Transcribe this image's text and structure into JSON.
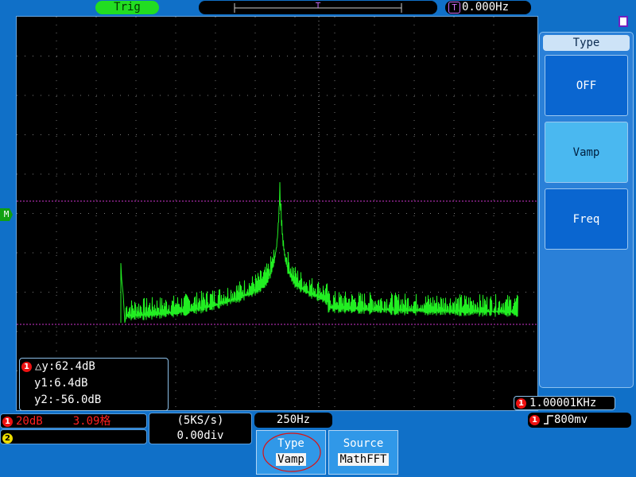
{
  "header": {
    "trigger_label": "Trig",
    "trig_freq_badge": "T",
    "trig_freq_value": "0.000Hz",
    "time_position_badge": "T"
  },
  "menu": {
    "title": "Type",
    "items": [
      {
        "label": "OFF",
        "selected": false
      },
      {
        "label": "Vamp",
        "selected": true
      },
      {
        "label": "Freq",
        "selected": false
      }
    ]
  },
  "measurement": {
    "channel_badge": "1",
    "delta": "△y:62.4dB",
    "y1": "y1:6.4dB",
    "y2": "y2:-56.0dB"
  },
  "channel1": {
    "badge": "1",
    "scale": "20dB",
    "offset": "3.09格"
  },
  "channel2": {
    "badge": "2"
  },
  "acquisition": {
    "sample_rate": "(5KS/s)",
    "position": "0.00div",
    "fft_span": "250Hz"
  },
  "readout": {
    "badge": "1",
    "frequency": "1.00001KHz"
  },
  "trigger": {
    "badge": "1",
    "level": "800mv",
    "slope_icon": "rising-edge-icon"
  },
  "softkeys": [
    {
      "label": "Type",
      "value": "Vamp",
      "highlighted": true
    },
    {
      "label": "Source",
      "value": "MathFFT",
      "highlighted": false
    }
  ],
  "math_marker": "M",
  "colors": {
    "trace": "#22ee22",
    "cursor": "#cc33cc",
    "background": "#1070c8"
  }
}
